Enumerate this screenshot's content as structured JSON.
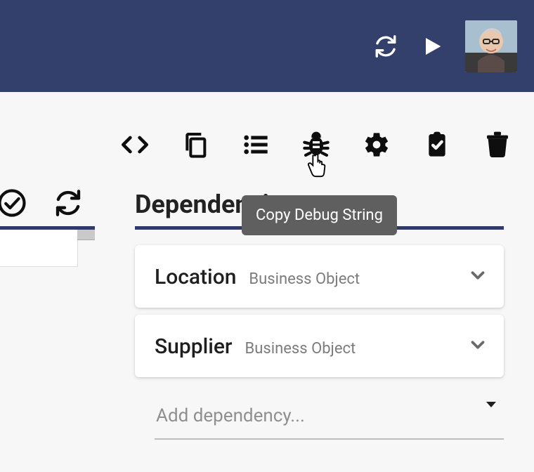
{
  "header": {
    "refresh_tooltip": "Refresh",
    "play_tooltip": "Run"
  },
  "toolbar": {
    "tooltip_debug": "Copy Debug String"
  },
  "section": {
    "title": "Dependencies"
  },
  "dependencies": [
    {
      "name": "Location",
      "type": "Business Object"
    },
    {
      "name": "Supplier",
      "type": "Business Object"
    }
  ],
  "add_dependency": {
    "placeholder": "Add dependency..."
  }
}
